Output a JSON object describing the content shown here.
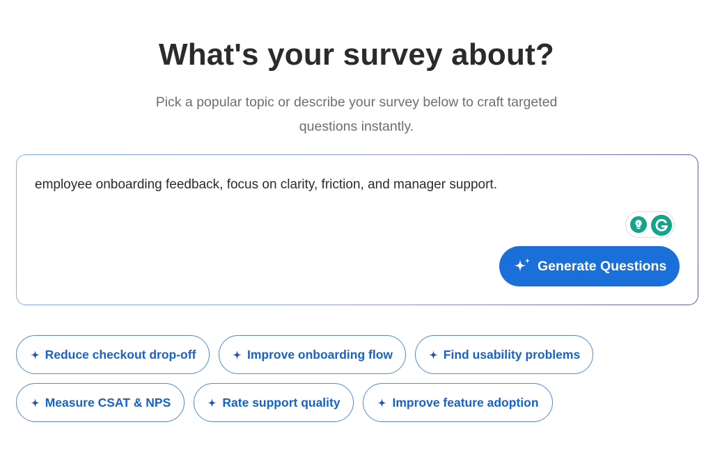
{
  "header": {
    "title": "What's your survey about?",
    "subtitle_line1": "Pick a popular topic or describe your survey below to craft targeted",
    "subtitle_line2": "questions instantly."
  },
  "prompt": {
    "value": "employee onboarding feedback, focus on clarity, friction, and manager support.",
    "extension_icons": [
      "lightbulb-icon",
      "grammarly-icon"
    ],
    "generate_label": "Generate Questions",
    "generate_icon": "sparkle-icon"
  },
  "suggestions": [
    {
      "label": "Reduce checkout drop-off"
    },
    {
      "label": "Improve onboarding flow"
    },
    {
      "label": "Find usability problems"
    },
    {
      "label": "Measure CSAT & NPS"
    },
    {
      "label": "Rate support quality"
    },
    {
      "label": "Improve feature adoption"
    }
  ],
  "colors": {
    "primary": "#1a6fd8",
    "chip_text": "#1762c9",
    "chip_border": "#4f8ad6",
    "title": "#2b2b2e",
    "subtitle": "#6b6e76",
    "grammarly": "#14a38b"
  }
}
